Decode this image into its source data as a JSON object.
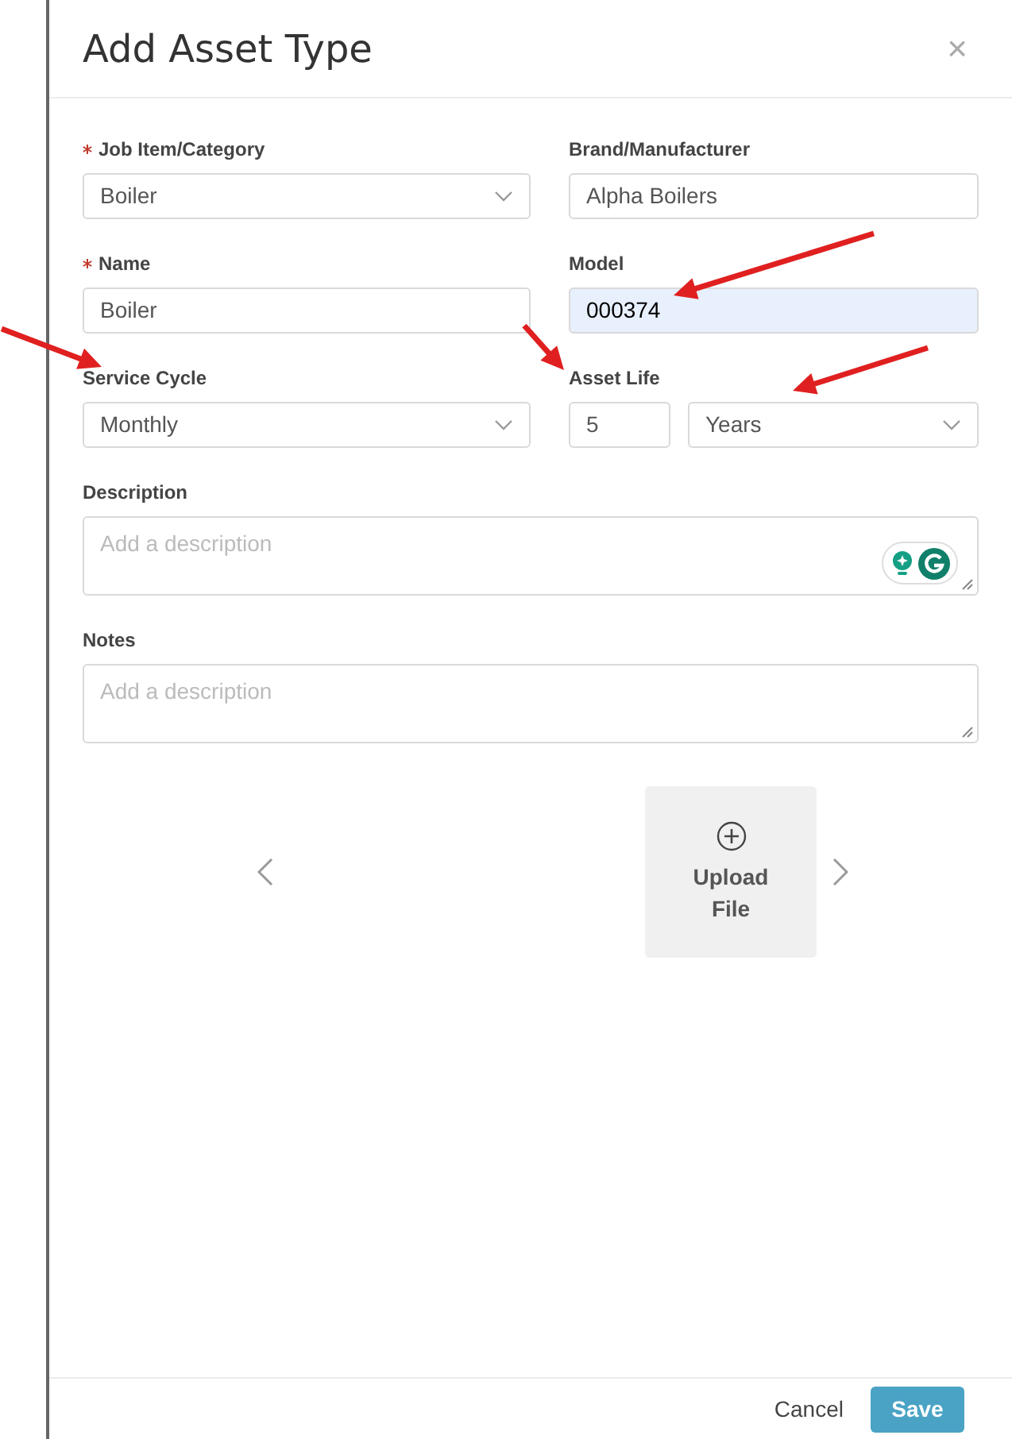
{
  "dialog": {
    "title": "Add Asset Type",
    "close": "×"
  },
  "rows": [
    [
      {
        "label": "Job Item/Category",
        "required": true,
        "kind": "select",
        "value": "Boiler",
        "highlighted": false
      },
      {
        "label": "Brand/Manufacturer",
        "required": false,
        "kind": "text",
        "value": "Alpha Boilers",
        "highlighted": false
      }
    ],
    [
      {
        "label": "Name",
        "required": true,
        "kind": "text",
        "value": "Boiler",
        "highlighted": false
      },
      {
        "label": "Model",
        "required": false,
        "kind": "text",
        "value": "000374",
        "highlighted": true
      }
    ],
    [
      {
        "label": "Service Cycle",
        "required": false,
        "kind": "select",
        "value": "Monthly",
        "highlighted": false
      },
      {
        "label": "Asset Life",
        "required": false,
        "kind": "life",
        "value": "5",
        "unit": "Years",
        "highlighted": false
      }
    ]
  ],
  "textareas": [
    {
      "label": "Description",
      "placeholder": "Add a description",
      "grammarly": true
    },
    {
      "label": "Notes",
      "placeholder": "Add a description",
      "grammarly": false
    }
  ],
  "upload": {
    "label": "Upload File"
  },
  "footer": {
    "cancel": "Cancel",
    "save": "Save"
  },
  "annotations": [
    {
      "kind": "arrow"
    },
    {
      "kind": "arrow"
    },
    {
      "kind": "arrow"
    },
    {
      "kind": "arrow"
    }
  ]
}
